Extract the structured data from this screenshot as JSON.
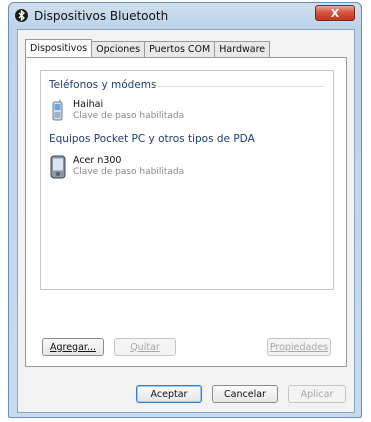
{
  "window": {
    "title": "Dispositivos Bluetooth",
    "close_label": "X"
  },
  "tabs": [
    {
      "label": "Dispositivos",
      "active": true
    },
    {
      "label": "Opciones",
      "active": false
    },
    {
      "label": "Puertos COM",
      "active": false
    },
    {
      "label": "Hardware",
      "active": false
    }
  ],
  "groups": [
    {
      "header": "Teléfonos y módems",
      "devices": [
        {
          "name": "Haihai",
          "status": "Clave de paso habilitada",
          "icon": "phone-icon"
        }
      ]
    },
    {
      "header": "Equipos Pocket PC y otros tipos de PDA",
      "devices": [
        {
          "name": "Acer n300",
          "status": "Clave de paso habilitada",
          "icon": "pda-icon"
        }
      ]
    }
  ],
  "panel_buttons": {
    "add": "Agregar...",
    "remove": "Quitar",
    "properties": "Propiedades"
  },
  "dialog_buttons": {
    "ok": "Aceptar",
    "cancel": "Cancelar",
    "apply": "Aplicar"
  },
  "colors": {
    "title_bar": "#c6dbee",
    "close_button": "#c2361e",
    "group_header": "#1e3d7a",
    "status_text": "#8a8a8a"
  }
}
